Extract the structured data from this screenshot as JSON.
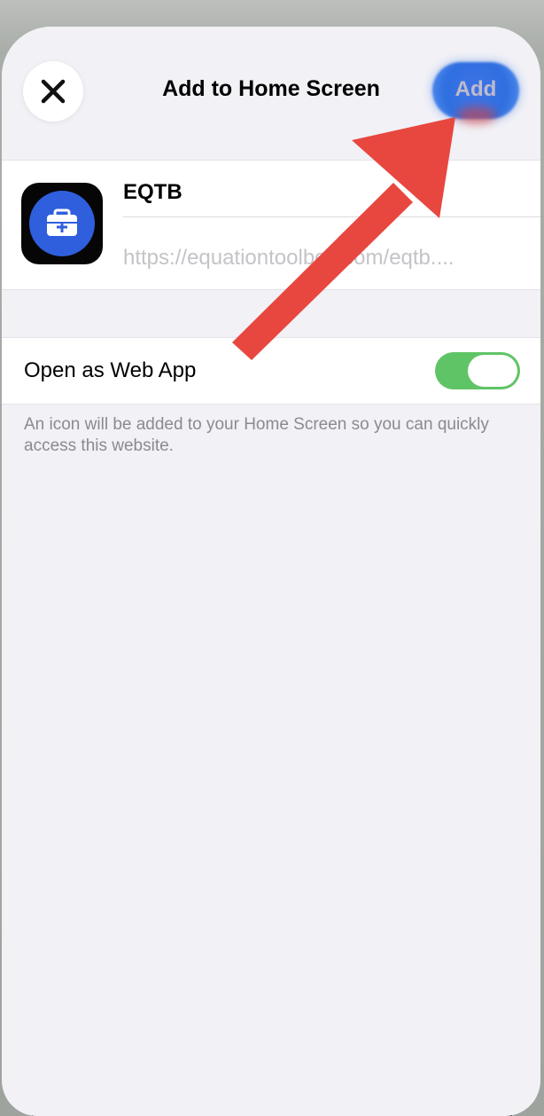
{
  "header": {
    "title": "Add to Home Screen",
    "add_label": "Add",
    "close_icon": "close-icon"
  },
  "app": {
    "name": "EQTB",
    "url": "https://equationtoolbox.com/eqtb....",
    "icon": "toolbox-icon",
    "icon_color": "#2f5fdc"
  },
  "settings": {
    "web_app_label": "Open as Web App",
    "web_app_enabled": true,
    "toggle_color": "#5fc466",
    "footnote": "An icon will be added to your Home Screen so you can quickly access this website."
  },
  "annotation": {
    "arrow_icon": "red-pointer-arrow-icon",
    "arrow_color": "#e8473f"
  }
}
